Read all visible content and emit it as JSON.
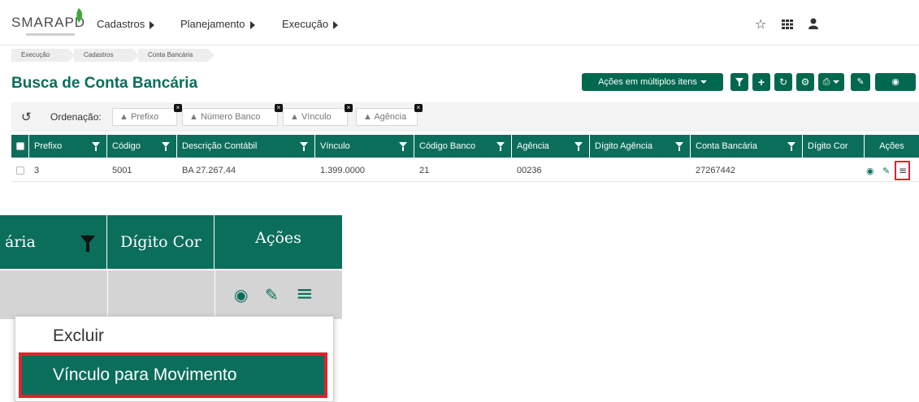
{
  "app": {
    "logo": "SMARAPD"
  },
  "nav": {
    "items": [
      {
        "label": "Cadastros"
      },
      {
        "label": "Planejamento"
      },
      {
        "label": "Execução"
      }
    ],
    "icons": [
      "star-icon",
      "grid-icon",
      "user-icon"
    ]
  },
  "breadcrumb": [
    "Execução",
    "Cadastros",
    "Conta Bancária"
  ],
  "page": {
    "title": "Busca de Conta Bancária"
  },
  "toolbar": {
    "bulk_actions_label": "Ações em múltiplos itens"
  },
  "sort": {
    "label": "Ordenação:",
    "chips": [
      "Prefixo",
      "Número Banco",
      "Vínculo",
      "Agência"
    ]
  },
  "table": {
    "columns": [
      "Prefixo",
      "Código",
      "Descrição Contábil",
      "Vínculo",
      "Código Banco",
      "Agência",
      "Dígito Agência",
      "Conta Bancária",
      "Dígito Cor",
      "Ações"
    ],
    "rows": [
      {
        "prefixo": "3",
        "codigo": "5001",
        "descricao": "BA 27.267.44",
        "vinculo": "1.399.0000",
        "codigo_banco": "21",
        "agencia": "00236",
        "digito_agencia": "",
        "conta": "27267442",
        "digito_conta": ""
      }
    ]
  },
  "zoom": {
    "columns": [
      "ária",
      "Dígito Cor",
      "Ações"
    ],
    "menu": [
      "Excluir",
      "Vínculo para Movimento"
    ]
  },
  "colors": {
    "primary": "#0b6e5b",
    "highlight": "#e0232b"
  }
}
